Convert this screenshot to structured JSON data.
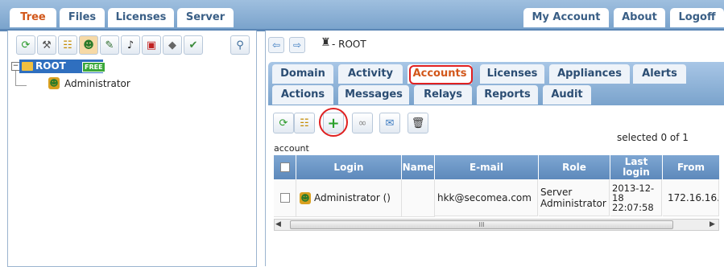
{
  "top_tabs": {
    "tree": "Tree",
    "files": "Files",
    "licenses": "Licenses",
    "server": "Server",
    "my_account": "My Account",
    "about": "About",
    "logoff": "Logoff"
  },
  "tree": {
    "root_label": "ROOT",
    "root_badge": "FREE",
    "child_label": "Administrator"
  },
  "header": {
    "path": "- ROOT"
  },
  "sub_tabs_row1": [
    "Domain",
    "Activity",
    "Accounts",
    "Licenses",
    "Appliances",
    "Alerts"
  ],
  "sub_tabs_row2": [
    "Actions",
    "Messages",
    "Relays",
    "Reports",
    "Audit"
  ],
  "selected_text": "selected 0 of 1",
  "section_label": "account",
  "table": {
    "headers": [
      "Login",
      "Name",
      "E-mail",
      "Role",
      "Last login",
      "From"
    ],
    "rows": [
      {
        "login": "Administrator ()",
        "name": "",
        "email": "hkk@secomea.com",
        "role": "Server Administrator",
        "last_login": "2013-12-18 22:07:58",
        "from": "172.16.16."
      }
    ]
  },
  "scrollbar_grip": "III",
  "colors": {
    "accent": "#d2571a",
    "header_blue": "#5d89bb",
    "highlight_red": "#e02020",
    "badge_green": "#3aa83a"
  }
}
